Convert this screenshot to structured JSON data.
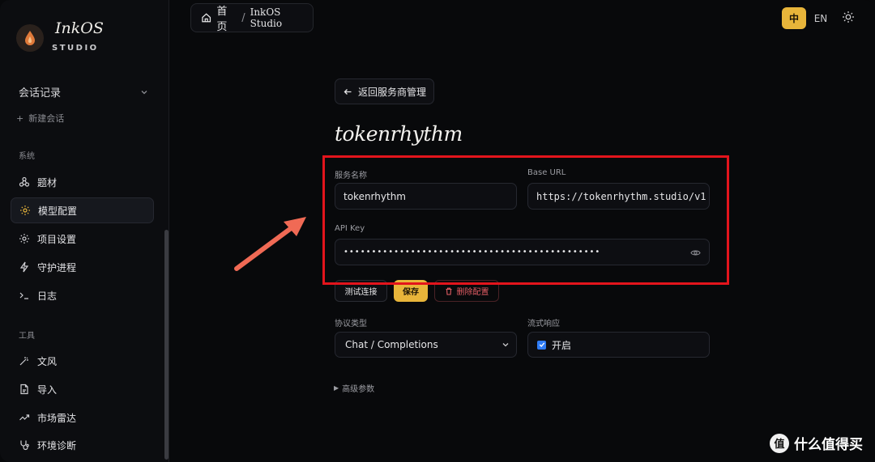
{
  "app": {
    "name": "InkOS",
    "subtitle": "STUDIO"
  },
  "sidebar": {
    "sessions_label": "会话记录",
    "new_session": "新建会话",
    "system_label": "系统",
    "system_items": [
      {
        "label": "题材",
        "icon": "network-icon"
      },
      {
        "label": "模型配置",
        "icon": "gear-icon",
        "active": true
      },
      {
        "label": "项目设置",
        "icon": "gear-icon"
      },
      {
        "label": "守护进程",
        "icon": "lightning-icon"
      },
      {
        "label": "日志",
        "icon": "terminal-icon"
      }
    ],
    "tools_label": "工具",
    "tool_items": [
      {
        "label": "文风",
        "icon": "wand-icon"
      },
      {
        "label": "导入",
        "icon": "file-icon"
      },
      {
        "label": "市场雷达",
        "icon": "trend-icon"
      },
      {
        "label": "环境诊断",
        "icon": "stethoscope-icon"
      }
    ]
  },
  "topbar": {
    "breadcrumb_home": "首页",
    "breadcrumb_sep": "/",
    "breadcrumb_current": "InkOS Studio",
    "lang_zh": "中",
    "lang_en": "EN"
  },
  "main": {
    "back_label": "返回服务商管理",
    "provider_title": "tokenrhythm",
    "service_name_label": "服务名称",
    "service_name_value": "tokenrhythm",
    "base_url_label": "Base URL",
    "base_url_value": "https://tokenrhythm.studio/v1",
    "api_key_label": "API Key",
    "api_key_value": "••••••••••••••••••••••••••••••••••••••••••••••",
    "test_button": "测试连接",
    "save_button": "保存",
    "delete_button": "删除配置",
    "protocol_label": "协议类型",
    "protocol_value": "Chat / Completions",
    "stream_label": "流式响应",
    "stream_value": "开启",
    "advanced_label": "高级参数"
  },
  "watermark": {
    "logo": "值",
    "text": "什么值得买"
  },
  "colors": {
    "accent": "#e8b53a",
    "annotation": "#e3141c",
    "danger": "#e35d64",
    "checkbox": "#2f7cf6"
  }
}
